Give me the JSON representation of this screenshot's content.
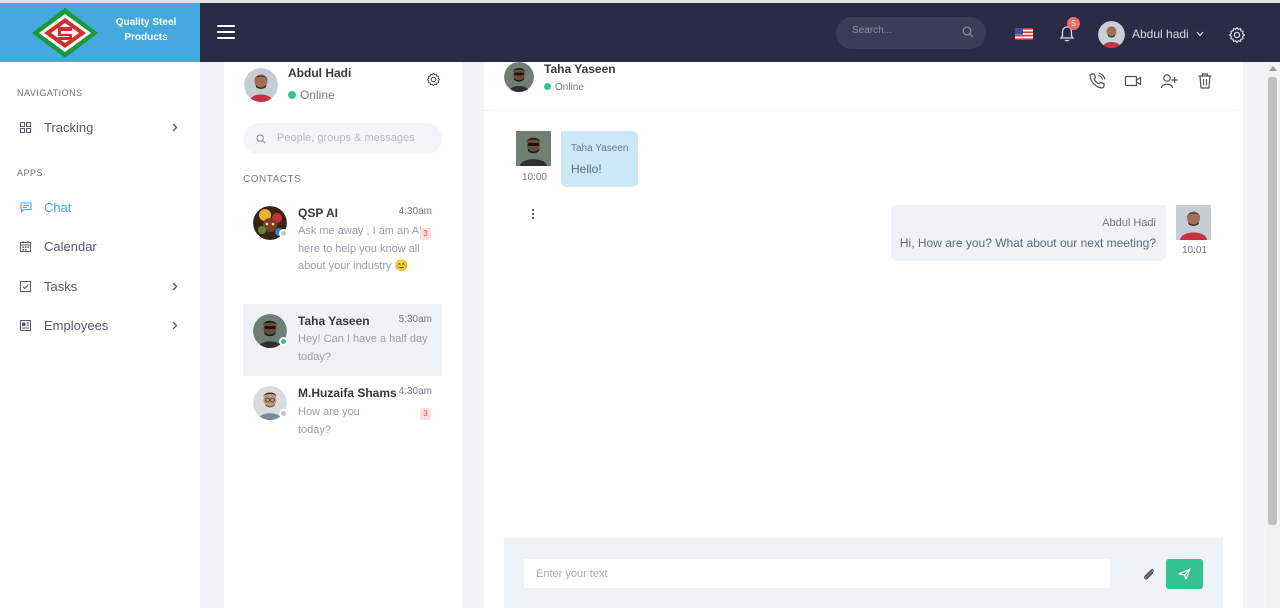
{
  "brand": {
    "name": "Quality Steel Products"
  },
  "topbar": {
    "search_placeholder": "Search...",
    "notifications_count": "5",
    "user_name": "Abdul hadi"
  },
  "sidebar": {
    "section_navigation": "NAVIGATIONS",
    "section_apps": "APPS",
    "items": [
      {
        "label": "Tracking",
        "icon": "grid-icon"
      },
      {
        "label": "Chat",
        "icon": "chat-icon",
        "active": true
      },
      {
        "label": "Calendar",
        "icon": "calendar-icon"
      },
      {
        "label": "Tasks",
        "icon": "checkbox-icon"
      },
      {
        "label": "Employees",
        "icon": "id-card-icon"
      }
    ]
  },
  "contacts_panel": {
    "me": {
      "name": "Abdul Hadi",
      "status": "Online"
    },
    "search_placeholder": "People, groups & messages",
    "title": "CONTACTS",
    "contacts": [
      {
        "name": "QSP AI",
        "time": "4:30am",
        "message": "Ask me away , I am an AI here to help you know all about your industry 😊",
        "unread": "3",
        "status": "offline"
      },
      {
        "name": "Taha Yaseen",
        "time": "5:30am",
        "message": "Hey! Can I have a half day today?",
        "unread": "",
        "status": "online"
      },
      {
        "name": "M.Huzaifa Shams",
        "time": "4:30am",
        "message": "How are you today?",
        "unread": "3",
        "status": "offline"
      }
    ]
  },
  "chat": {
    "header": {
      "name": "Taha Yaseen",
      "status": "Online"
    },
    "messages": [
      {
        "sender": "Taha Yaseen",
        "text": "Hello!",
        "time": "10:00",
        "direction": "in"
      },
      {
        "sender": "Abdul Hadi",
        "text": "Hi, How are you? What about our next meeting?",
        "time": "10:01",
        "direction": "out"
      }
    ],
    "composer_placeholder": "Enter your text"
  },
  "colors": {
    "topbar": "#2a2b44",
    "brand": "#45a9de",
    "accent": "#45a9de",
    "online": "#34c38f",
    "send": "#34c38f",
    "badge": "#f46a6a"
  }
}
